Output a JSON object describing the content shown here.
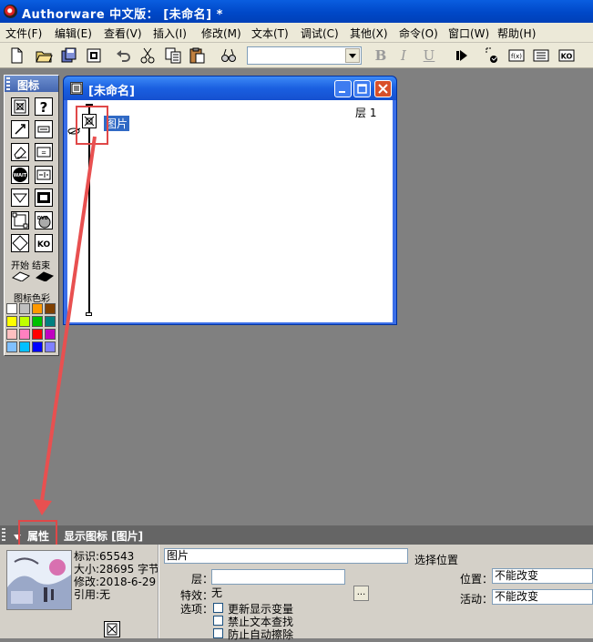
{
  "app": {
    "title": "Authorware 中文版： [未命名] *"
  },
  "menu": [
    {
      "label": "文件(F)"
    },
    {
      "label": "编辑(E)"
    },
    {
      "label": "查看(V)"
    },
    {
      "label": "插入(I)"
    },
    {
      "label": "修改(M)"
    },
    {
      "label": "文本(T)"
    },
    {
      "label": "调试(C)"
    },
    {
      "label": "其他(X)"
    },
    {
      "label": "命令(O)"
    },
    {
      "label": "窗口(W)"
    },
    {
      "label": "帮助(H)"
    }
  ],
  "toolbar": {
    "font_combo_value": "",
    "bold_label": "B",
    "italic_label": "I",
    "underline_label": "U"
  },
  "palette": {
    "title": "图标",
    "start_end_label": "开始 结束",
    "color_label": "图标色彩",
    "colors": [
      "#ffffff",
      "#c0c0c0",
      "#ff9900",
      "#804000",
      "#ffff00",
      "#c0ff00",
      "#00c000",
      "#008080",
      "#ffc0c0",
      "#ff80c0",
      "#ff0000",
      "#c000c0",
      "#80c0ff",
      "#00c0ff",
      "#0000ff",
      "#8080ff"
    ]
  },
  "flow_window": {
    "title": "[未命名]",
    "layer_label": "层 1",
    "icon_name": "图片"
  },
  "properties": {
    "tab_label": "属性",
    "header_title": "显示图标 [图片]",
    "info_id": "标识:65543",
    "info_size": "大小:28695 字节",
    "info_modified": "修改:2018-6-29",
    "info_ref": "引用:无",
    "name_value": "图片",
    "select_position_label": "选择位置",
    "layer_label": "层：",
    "layer_value": "",
    "effect_label": "特效：",
    "effect_value": "无",
    "effect_button": "...",
    "options_label": "选项：",
    "options": [
      {
        "label": "更新显示变量",
        "checked": false
      },
      {
        "label": "禁止文本查找",
        "checked": false
      },
      {
        "label": "防止自动擦除",
        "checked": false
      }
    ],
    "position_label": "位置：",
    "position_value": "不能改变",
    "activity_label": "活动：",
    "activity_value": "不能改变"
  },
  "colors": {
    "highlight_box": "#e04848",
    "arrow": "#e85050",
    "selection_bg": "#316ac5"
  }
}
